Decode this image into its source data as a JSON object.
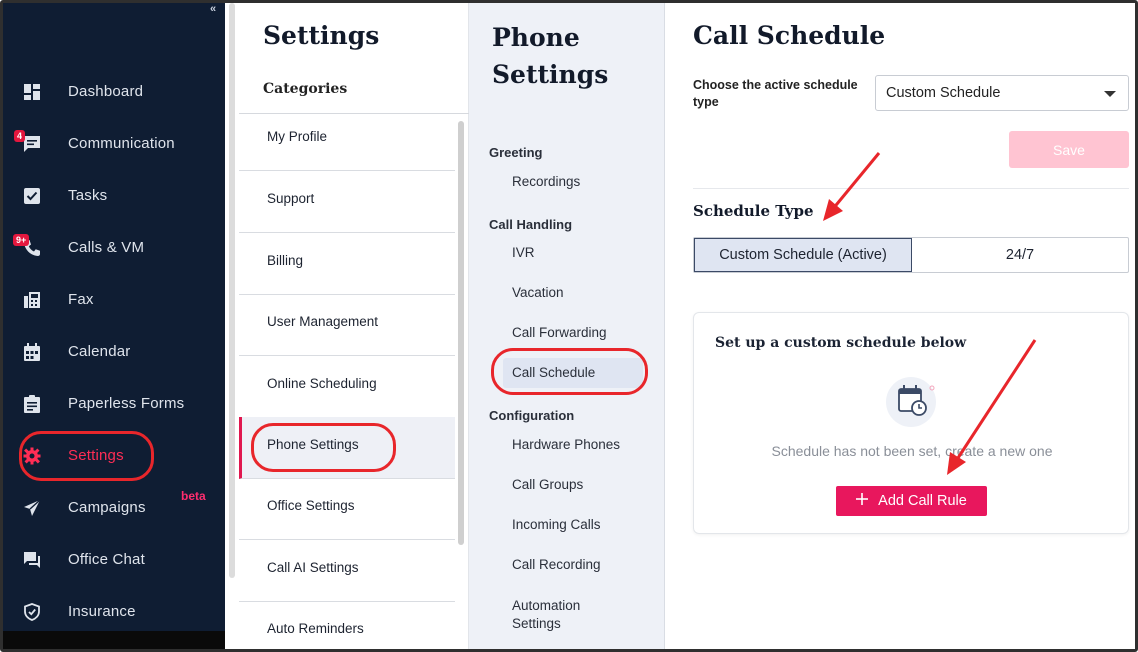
{
  "nav": {
    "collapse_glyph": "«",
    "items": [
      {
        "label": "Dashboard",
        "icon": "dashboard-icon"
      },
      {
        "label": "Communication",
        "icon": "chat-icon",
        "badge": "4"
      },
      {
        "label": "Tasks",
        "icon": "checkbox-icon"
      },
      {
        "label": "Calls & VM",
        "icon": "phone-icon",
        "badge": "9+"
      },
      {
        "label": "Fax",
        "icon": "fax-icon"
      },
      {
        "label": "Calendar",
        "icon": "calendar-icon"
      },
      {
        "label": "Paperless Forms",
        "icon": "clipboard-icon"
      },
      {
        "label": "Settings",
        "icon": "gear-icon",
        "active": true
      },
      {
        "label": "Campaigns",
        "icon": "send-icon",
        "tag": "beta"
      },
      {
        "label": "Office Chat",
        "icon": "office-chat-icon"
      },
      {
        "label": "Insurance",
        "icon": "shield-icon"
      }
    ],
    "beta_label": "beta",
    "active_color": "#ff2d55"
  },
  "settings": {
    "title": "Settings",
    "categories_label": "Categories",
    "items": [
      "My Profile",
      "Support",
      "Billing",
      "User Management",
      "Online Scheduling",
      "Phone Settings",
      "Office Settings",
      "Call AI Settings",
      "Auto Reminders"
    ],
    "selected": "Phone Settings"
  },
  "phone_settings": {
    "title": "Phone Settings",
    "groups": [
      {
        "label": "Greeting",
        "items": [
          "Recordings"
        ]
      },
      {
        "label": "Call Handling",
        "items": [
          "IVR",
          "Vacation",
          "Call Forwarding",
          "Call Schedule"
        ]
      },
      {
        "label": "Configuration",
        "items": [
          "Hardware Phones",
          "Call Groups",
          "Incoming Calls",
          "Call Recording",
          "Automation Settings"
        ]
      }
    ],
    "selected": "Call Schedule"
  },
  "main": {
    "title": "Call Schedule",
    "choose_label": "Choose the active schedule type",
    "select_value": "Custom Schedule",
    "save_label": "Save",
    "schedule_type_label": "Schedule Type",
    "toggle_options": [
      "Custom Schedule (Active)",
      "24/7"
    ],
    "card_title": "Set up a custom schedule below",
    "empty_text": "Schedule has not been set, create a new one",
    "add_label": "Add Call Rule",
    "accent_color": "#e8175d",
    "annotation_color": "#e8262b"
  }
}
